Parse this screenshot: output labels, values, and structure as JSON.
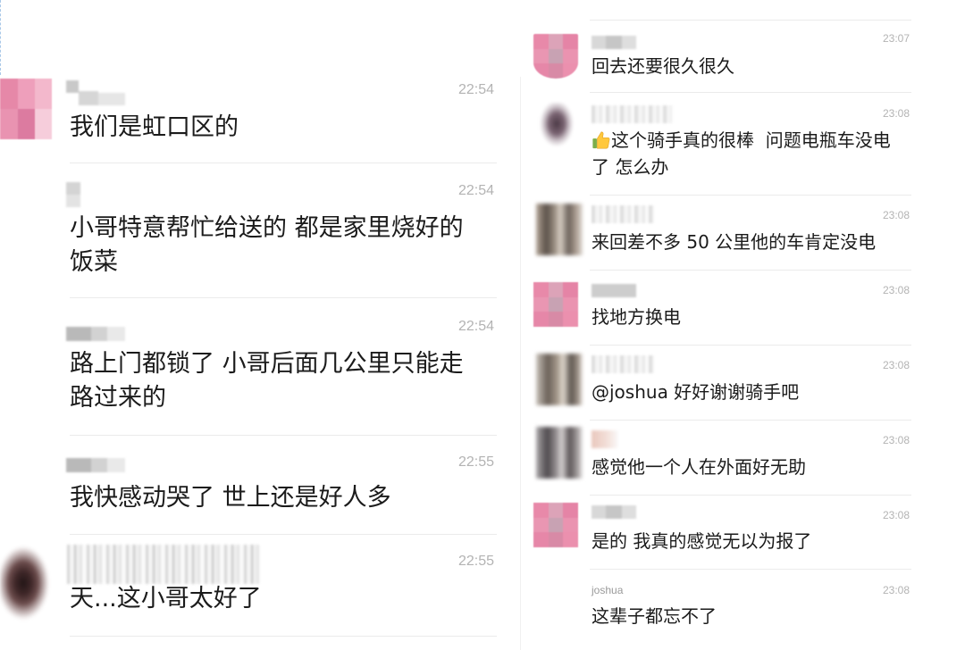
{
  "colors": {
    "background": "#ffffff",
    "message_text": "#1b1b1b",
    "timestamp": "#b3b3b3",
    "divider": "#ebebeb",
    "sender_name": "#9a9a9a",
    "thumbs_up": "#ffc83d"
  },
  "left_panel": {
    "messages": [
      {
        "time": "22:54",
        "lines": [
          "我们是虹口区的"
        ]
      },
      {
        "time": "22:54",
        "lines": [
          "小哥特意帮忙给送的 都是家里烧好的",
          "饭菜"
        ]
      },
      {
        "time": "22:54",
        "lines": [
          "路上门都锁了 小哥后面几公里只能走",
          "路过来的"
        ]
      },
      {
        "time": "22:55",
        "lines": [
          "我快感动哭了 世上还是好人多"
        ]
      },
      {
        "time": "22:55",
        "lines": [
          "天...这小哥太好了"
        ]
      }
    ]
  },
  "right_panel": {
    "messages": [
      {
        "time": "23:07",
        "lines": [
          "回去还要很久很久"
        ]
      },
      {
        "time": "23:08",
        "icon": "thumbs-up",
        "lines": [
          "这个骑手真的很棒  问题电瓶车没电",
          "了 怎么办"
        ]
      },
      {
        "time": "23:08",
        "lines": [
          "来回差不多 50 公里他的车肯定没电"
        ]
      },
      {
        "time": "23:08",
        "lines": [
          "找地方换电"
        ]
      },
      {
        "time": "23:08",
        "lines": [
          "@joshua 好好谢谢骑手吧"
        ]
      },
      {
        "time": "23:08",
        "lines": [
          "感觉他一个人在外面好无助"
        ]
      },
      {
        "time": "23:08",
        "lines": [
          "是的 我真的感觉无以为报了"
        ]
      },
      {
        "time": "23:08",
        "sender": "joshua",
        "lines": [
          "这辈子都忘不了"
        ]
      }
    ]
  }
}
